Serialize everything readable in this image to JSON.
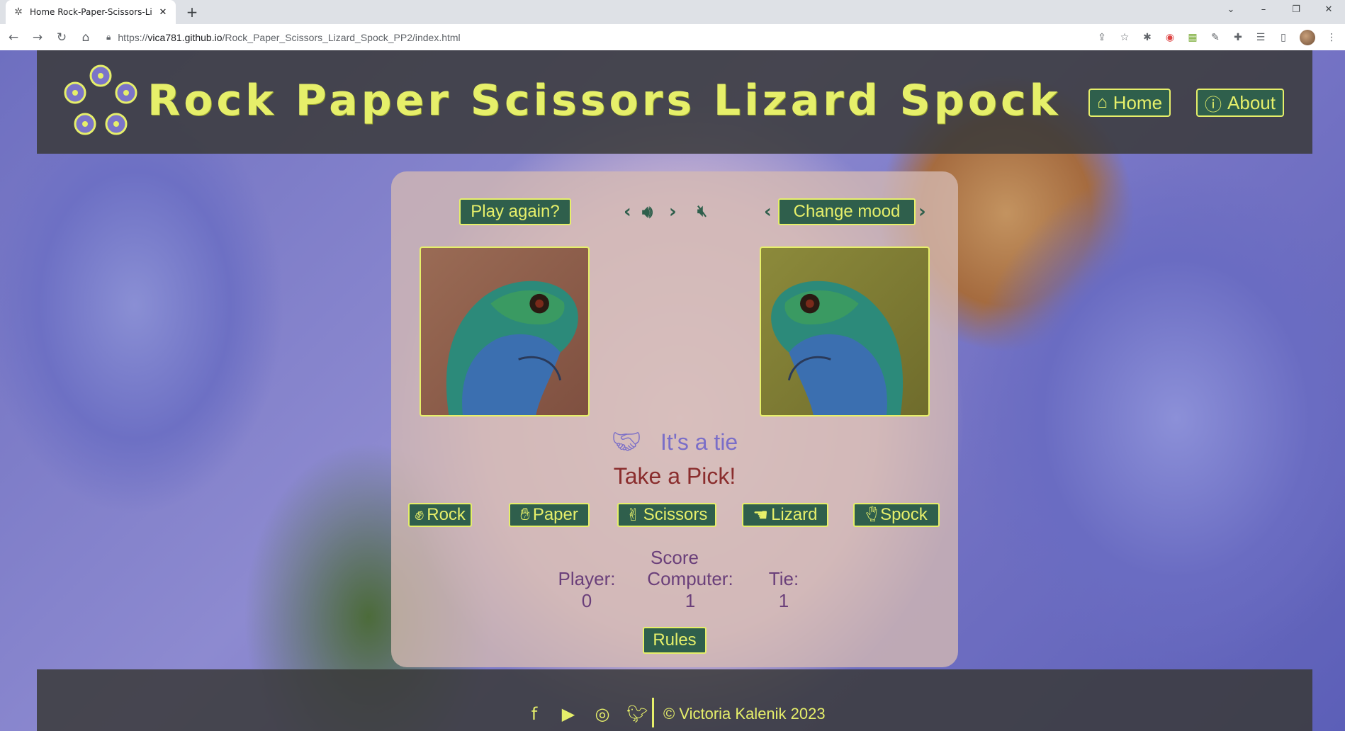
{
  "browser": {
    "tab_title": "Home Rock-Paper-Scissors-Lizard",
    "url_prefix": "https://",
    "url_host": "vica781.github.io",
    "url_path": "/Rock_Paper_Scissors_Lizard_Spock_PP2/index.html"
  },
  "header": {
    "title": "Rock Paper Scissors Lizard Spock",
    "nav": {
      "home": "Home",
      "about": "About"
    }
  },
  "game": {
    "play_again": "Play again?",
    "change_mood": "Change mood",
    "result": "It's a tie",
    "prompt": "Take a Pick!",
    "choices": [
      "Rock",
      "Paper",
      "Scissors",
      "Lizard",
      "Spock"
    ],
    "score_title": "Score",
    "score": {
      "player_label": "Player:",
      "player_value": "0",
      "computer_label": "Computer:",
      "computer_value": "1",
      "tie_label": "Tie:",
      "tie_value": "1"
    },
    "rules": "Rules",
    "player_choice_icon": "lizard-image",
    "computer_choice_icon": "lizard-image"
  },
  "footer": {
    "copyright": "© Victoria Kalenik 2023",
    "social": [
      "facebook-icon",
      "youtube-icon",
      "instagram-icon",
      "twitter-icon"
    ]
  },
  "colors": {
    "accent": "#e6ef6a",
    "button_bg": "#2f5f4c",
    "header_bg": "#3a3a3a",
    "result": "#7a6ec8",
    "prompt": "#8a2d2d",
    "score": "#6a3f7a"
  }
}
